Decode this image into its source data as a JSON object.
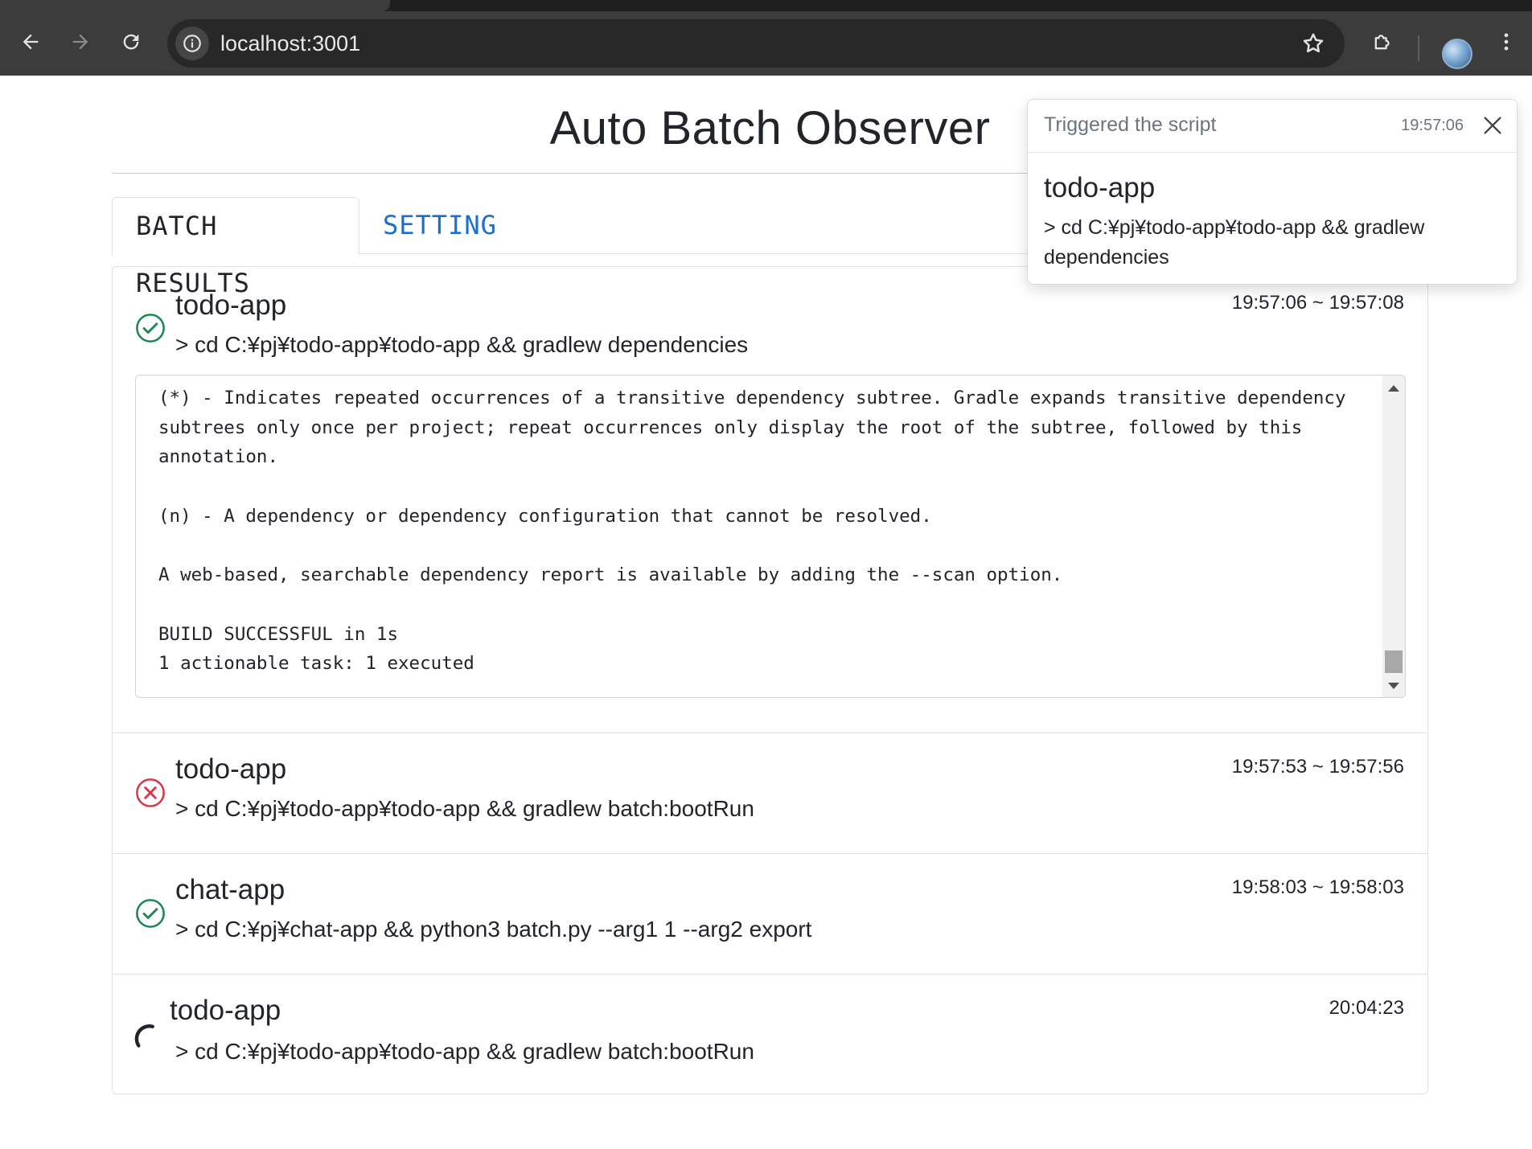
{
  "browser": {
    "url": "localhost:3001"
  },
  "page": {
    "title": "Auto Batch Observer"
  },
  "tabs": [
    {
      "label": "BATCH RESULTS",
      "active": true
    },
    {
      "label": "SETTING",
      "active": false
    }
  ],
  "results": [
    {
      "status": "success",
      "name": "todo-app",
      "command": "> cd C:¥pj¥todo-app¥todo-app && gradlew dependencies",
      "time": "19:57:06 ~ 19:57:08",
      "output": "(*) - Indicates repeated occurrences of a transitive dependency subtree. Gradle expands transitive dependency subtrees only once per project; repeat occurrences only display the root of the subtree, followed by this annotation.\n\n(n) - A dependency or dependency configuration that cannot be resolved.\n\nA web-based, searchable dependency report is available by adding the --scan option.\n\nBUILD SUCCESSFUL in 1s\n1 actionable task: 1 executed"
    },
    {
      "status": "failure",
      "name": "todo-app",
      "command": "> cd C:¥pj¥todo-app¥todo-app && gradlew batch:bootRun",
      "time": "19:57:53 ~ 19:57:56"
    },
    {
      "status": "success",
      "name": "chat-app",
      "command": "> cd C:¥pj¥chat-app && python3 batch.py --arg1 1 --arg2 export",
      "time": "19:58:03 ~ 19:58:03"
    },
    {
      "status": "running",
      "name": "todo-app",
      "command": "> cd C:¥pj¥todo-app¥todo-app && gradlew batch:bootRun",
      "time": "20:04:23"
    }
  ],
  "toast": {
    "title": "Triggered the script",
    "time": "19:57:06",
    "app": "todo-app",
    "command": "> cd C:¥pj¥todo-app¥todo-app && gradlew dependencies"
  },
  "colors": {
    "success": "#198754",
    "failure": "#dc3545",
    "link": "#1a6fd0"
  }
}
